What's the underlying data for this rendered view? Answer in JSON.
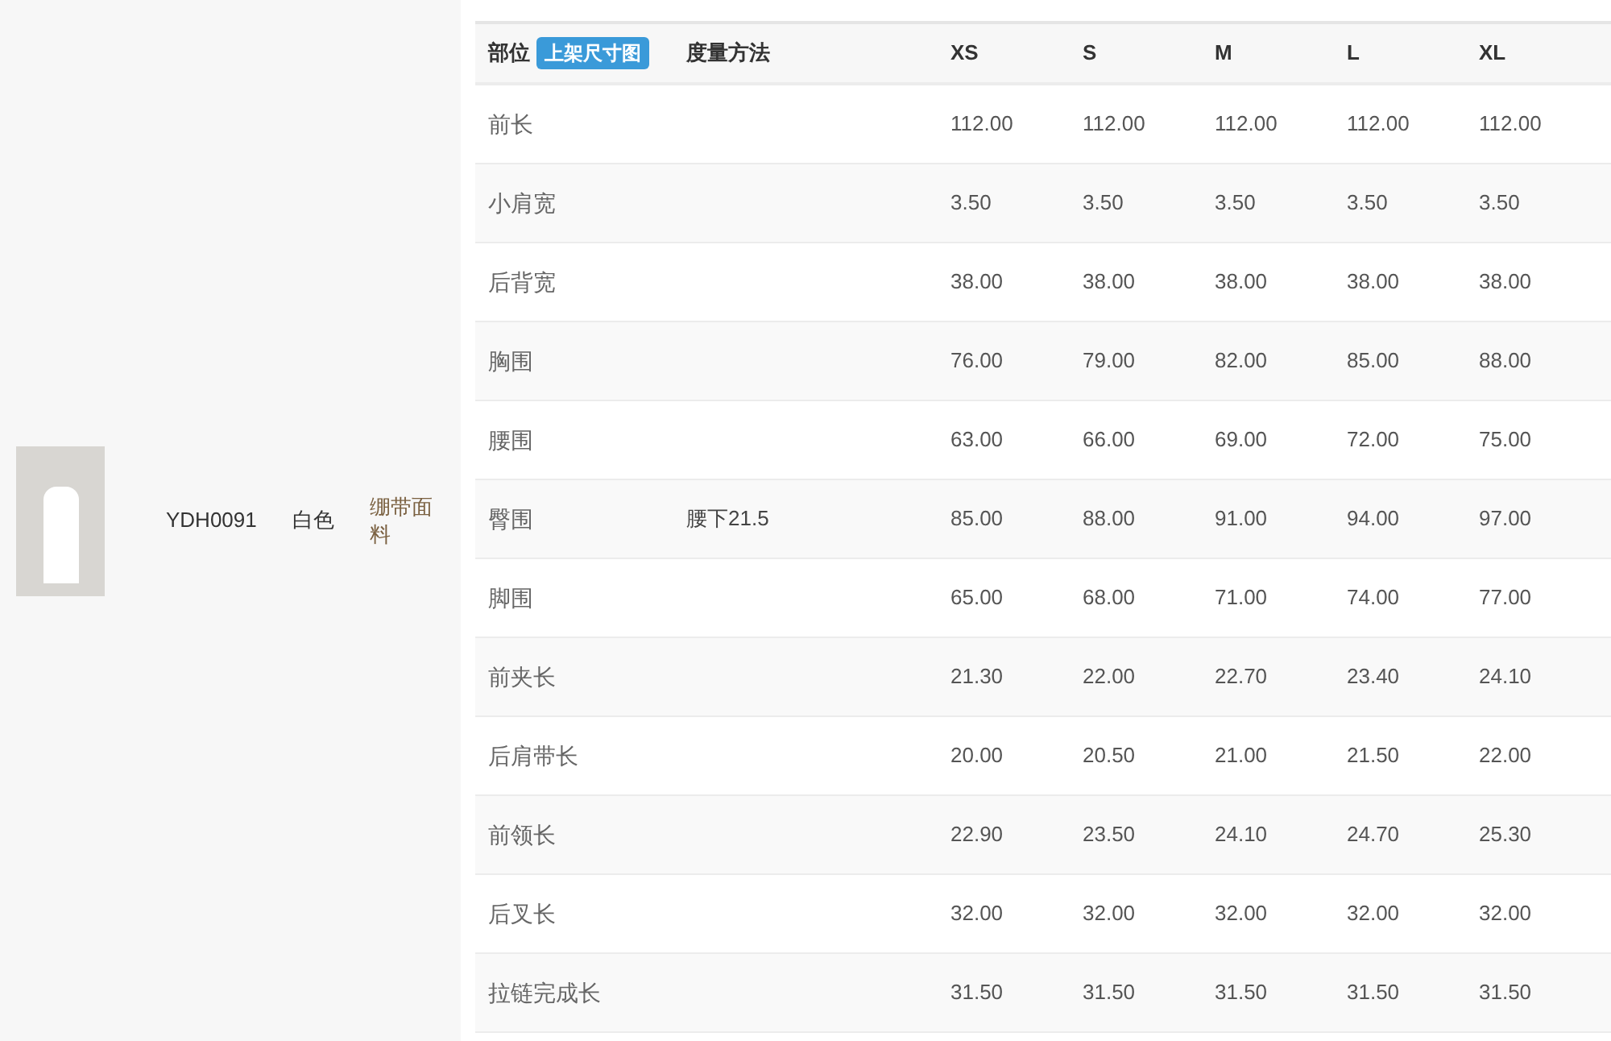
{
  "product": {
    "code": "YDH0091",
    "color_name": "白色",
    "material": "绷带面料"
  },
  "size_table": {
    "columns": {
      "part": "部位",
      "badge": "上架尺寸图",
      "method": "度量方法",
      "sizes": [
        "XS",
        "S",
        "M",
        "L",
        "XL"
      ]
    },
    "rows": [
      {
        "part": "前长",
        "method": "",
        "values": [
          "112.00",
          "112.00",
          "112.00",
          "112.00",
          "112.00"
        ]
      },
      {
        "part": "小肩宽",
        "method": "",
        "values": [
          "3.50",
          "3.50",
          "3.50",
          "3.50",
          "3.50"
        ]
      },
      {
        "part": "后背宽",
        "method": "",
        "values": [
          "38.00",
          "38.00",
          "38.00",
          "38.00",
          "38.00"
        ]
      },
      {
        "part": "胸围",
        "method": "",
        "values": [
          "76.00",
          "79.00",
          "82.00",
          "85.00",
          "88.00"
        ]
      },
      {
        "part": "腰围",
        "method": "",
        "values": [
          "63.00",
          "66.00",
          "69.00",
          "72.00",
          "75.00"
        ]
      },
      {
        "part": "臀围",
        "method": "腰下21.5",
        "values": [
          "85.00",
          "88.00",
          "91.00",
          "94.00",
          "97.00"
        ]
      },
      {
        "part": "脚围",
        "method": "",
        "values": [
          "65.00",
          "68.00",
          "71.00",
          "74.00",
          "77.00"
        ]
      },
      {
        "part": "前夹长",
        "method": "",
        "values": [
          "21.30",
          "22.00",
          "22.70",
          "23.40",
          "24.10"
        ]
      },
      {
        "part": "后肩带长",
        "method": "",
        "values": [
          "20.00",
          "20.50",
          "21.00",
          "21.50",
          "22.00"
        ]
      },
      {
        "part": "前领长",
        "method": "",
        "values": [
          "22.90",
          "23.50",
          "24.10",
          "24.70",
          "25.30"
        ]
      },
      {
        "part": "后叉长",
        "method": "",
        "values": [
          "32.00",
          "32.00",
          "32.00",
          "32.00",
          "32.00"
        ]
      },
      {
        "part": "拉链完成长",
        "method": "",
        "values": [
          "31.50",
          "31.50",
          "31.50",
          "31.50",
          "31.50"
        ]
      }
    ]
  }
}
